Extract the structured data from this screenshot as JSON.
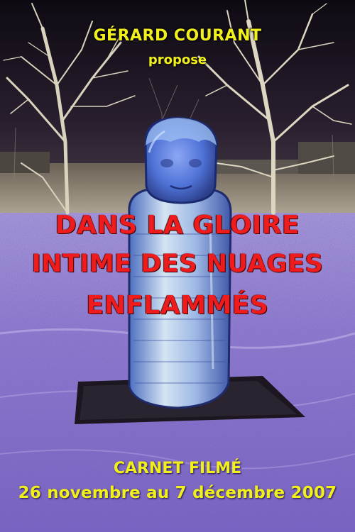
{
  "poster": {
    "director": "GÉRARD COURANT",
    "presents": "propose",
    "title_lines": [
      "DANS LA GLOIRE",
      "INTIME DES NUAGES",
      "ENFLAMMÉS"
    ],
    "subtitle": "CARNET FILMÉ",
    "dates": "26 novembre au 7 décembre 2007"
  },
  "colors": {
    "credit_text": "#f2f01a",
    "title_text": "#ee1c1c",
    "ground": "#8f7ad6",
    "night_sky": "#140f1c",
    "statue": "#6f93e0"
  }
}
